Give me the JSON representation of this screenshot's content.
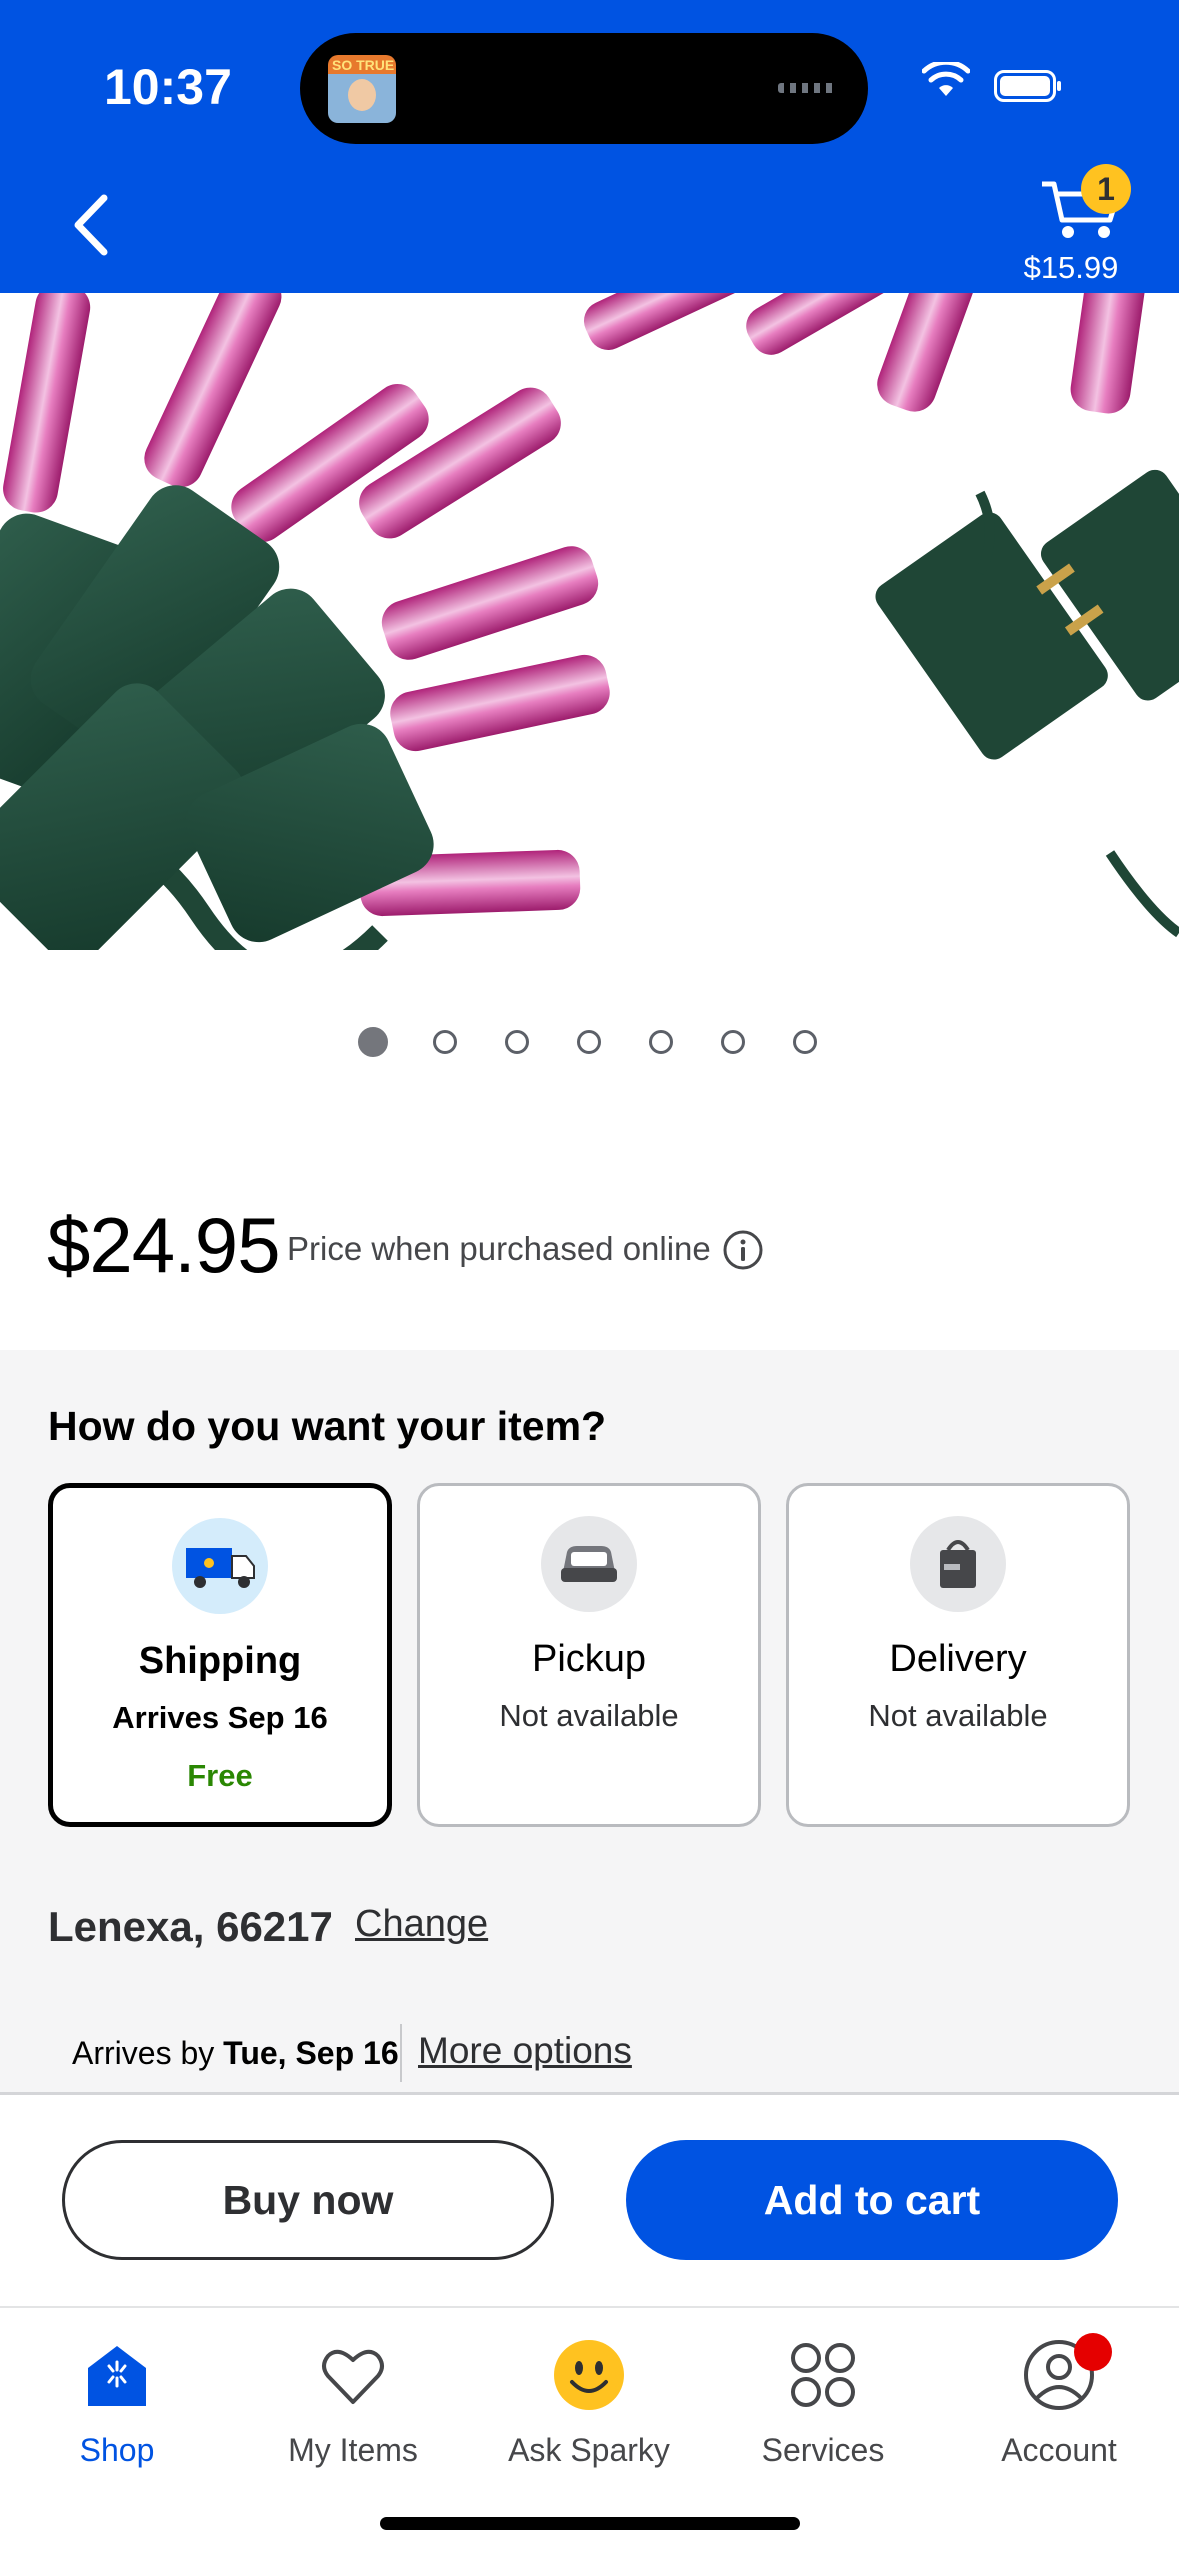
{
  "status_bar": {
    "time": "10:37",
    "live_activity_badge": "SO TRUE"
  },
  "header": {
    "cart_count": "1",
    "cart_total": "$15.99"
  },
  "carousel": {
    "total": 7,
    "active_index": 0
  },
  "price": {
    "amount": "$24.95",
    "note": "Price when purchased online"
  },
  "fulfillment": {
    "question": "How do you want your item?",
    "options": [
      {
        "title": "Shipping",
        "subtitle": "Arrives Sep 16",
        "extra": "Free",
        "selected": true,
        "icon": "shipping-truck-icon"
      },
      {
        "title": "Pickup",
        "subtitle": "Not available",
        "selected": false,
        "icon": "pickup-car-icon"
      },
      {
        "title": "Delivery",
        "subtitle": "Not available",
        "selected": false,
        "icon": "delivery-bag-icon"
      }
    ],
    "location": "Lenexa, 66217",
    "change_label": "Change",
    "arrives_prefix": "Arrives by ",
    "arrives_date": "Tue, Sep 16",
    "more_options": "More options"
  },
  "actions": {
    "buy_now": "Buy now",
    "add_to_cart": "Add to cart"
  },
  "tabs": [
    {
      "label": "Shop",
      "icon": "shop-icon",
      "active": true
    },
    {
      "label": "My Items",
      "icon": "heart-icon",
      "active": false
    },
    {
      "label": "Ask Sparky",
      "icon": "smiley-icon",
      "active": false
    },
    {
      "label": "Services",
      "icon": "services-grid-icon",
      "active": false
    },
    {
      "label": "Account",
      "icon": "account-icon",
      "active": false
    }
  ],
  "colors": {
    "brand_blue": "#0053e2",
    "badge_yellow": "#ffc220",
    "free_green": "#2a8703",
    "notification_red": "#e50000"
  }
}
